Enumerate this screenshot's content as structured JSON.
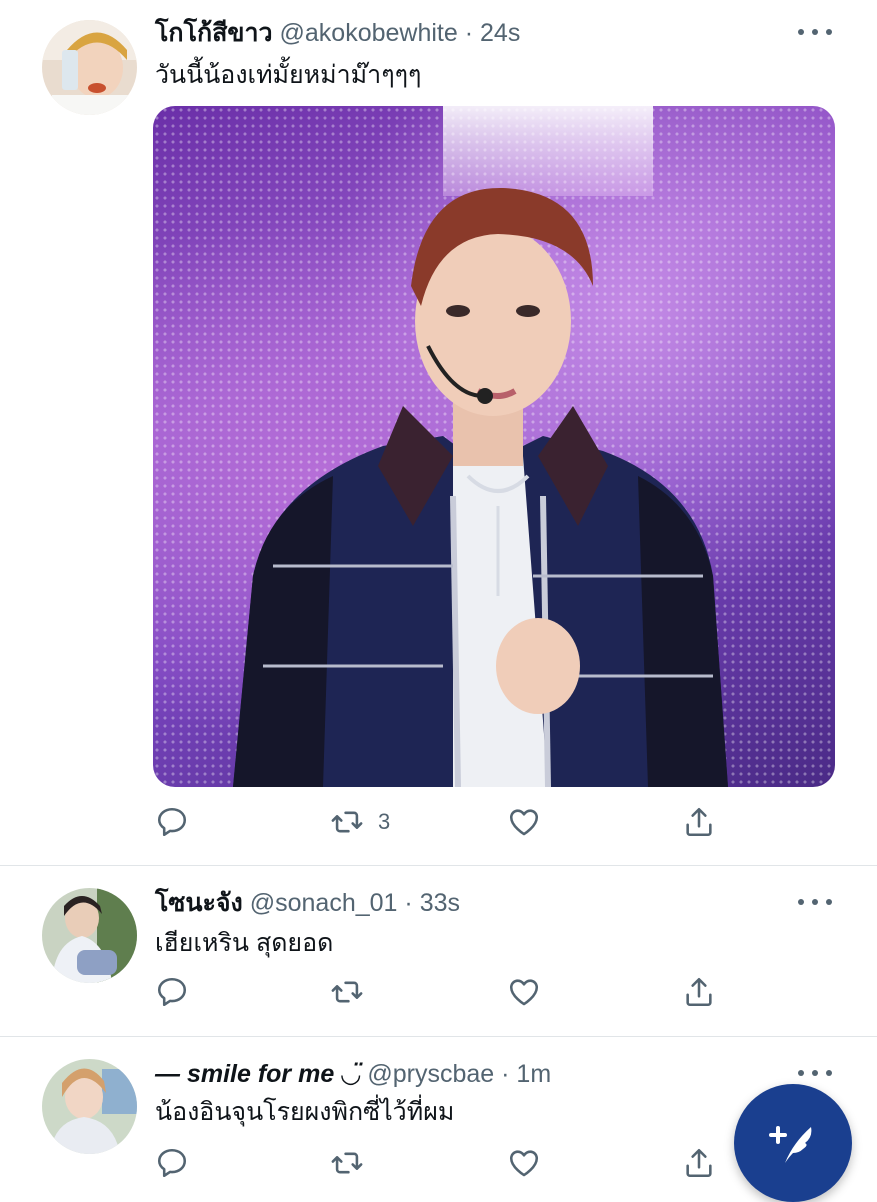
{
  "tweets": [
    {
      "name": "โกโก้สีขาว",
      "handle": "@akokobewhite",
      "separator": "·",
      "time": "24s",
      "text": "วันนี้น้องเท่มั้ยหม่าม๊าๆๆๆ",
      "actions": {
        "reply_count": "",
        "retweet_count": "3",
        "like_count": ""
      }
    },
    {
      "name": "โซนะจัง",
      "handle": "@sonach_01",
      "separator": "·",
      "time": "33s",
      "text": "เฮียเหริน สุดยอด",
      "actions": {
        "reply_count": "",
        "retweet_count": "",
        "like_count": ""
      }
    },
    {
      "name": "— smile for me ◡̈",
      "handle": "@pryscbae",
      "separator": "·",
      "time": "1m",
      "text": "น้องอินจุนโรยผงพิกซี่ไว้ที่ผม",
      "actions": {
        "reply_count": "",
        "retweet_count": "",
        "like_count": ""
      }
    }
  ],
  "icons": {
    "reply": "reply-icon",
    "retweet": "retweet-icon",
    "like": "heart-icon",
    "share": "share-icon",
    "more": "more-dots-icon",
    "compose": "compose-feather-icon"
  },
  "colors": {
    "text": "#0f1419",
    "secondary": "#536471",
    "divider": "#e1e5e8",
    "fab": "#1a3f8f"
  }
}
